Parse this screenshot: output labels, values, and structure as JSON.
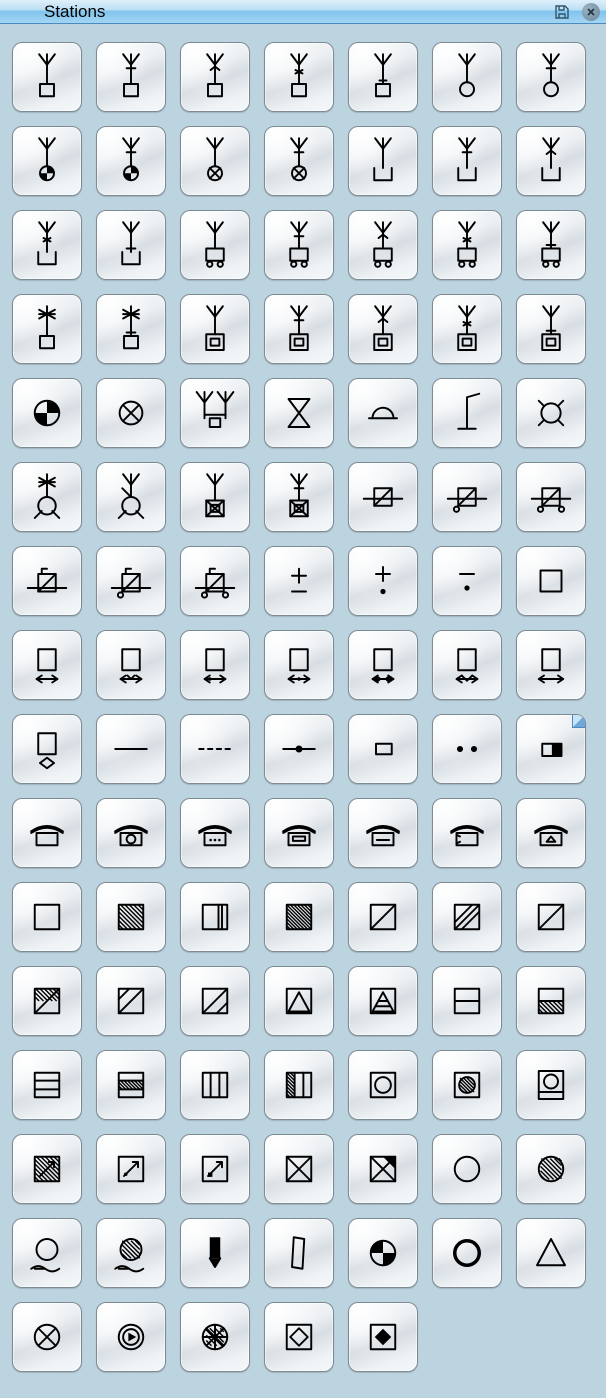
{
  "panel": {
    "title": "Stations",
    "save_tooltip": "Save",
    "close_tooltip": "Close"
  },
  "grid": {
    "columns": 7,
    "items": [
      {
        "id": "antenna-square-1",
        "label": "Antenna over square variant 1"
      },
      {
        "id": "antenna-square-2",
        "label": "Antenna over square variant 2"
      },
      {
        "id": "antenna-square-3",
        "label": "Antenna over square variant 3"
      },
      {
        "id": "antenna-square-4",
        "label": "Antenna over square variant 4"
      },
      {
        "id": "antenna-square-5",
        "label": "Antenna over square variant 5"
      },
      {
        "id": "antenna-circle-1",
        "label": "Antenna over circle"
      },
      {
        "id": "antenna-circle-2",
        "label": "Antenna over circle variant 2"
      },
      {
        "id": "antenna-filled-circle-1",
        "label": "Antenna over filled-sector circle 1"
      },
      {
        "id": "antenna-filled-circle-2",
        "label": "Antenna over filled-sector circle 2"
      },
      {
        "id": "antenna-cross-circle-1",
        "label": "Antenna over crossed circle 1"
      },
      {
        "id": "antenna-cross-circle-2",
        "label": "Antenna over crossed circle 2"
      },
      {
        "id": "antenna-open-box-1",
        "label": "Antenna over open-top box 1"
      },
      {
        "id": "antenna-open-box-2",
        "label": "Antenna over open-top box 2"
      },
      {
        "id": "antenna-open-box-3",
        "label": "Antenna over open-top box 3"
      },
      {
        "id": "antenna-open-box-4",
        "label": "Antenna over open-top box 4"
      },
      {
        "id": "antenna-open-box-5",
        "label": "Antenna over open-top box 5"
      },
      {
        "id": "antenna-wheels-1",
        "label": "Antenna over box with wheels 1"
      },
      {
        "id": "antenna-wheels-2",
        "label": "Antenna over box with wheels 2"
      },
      {
        "id": "antenna-wheels-3",
        "label": "Antenna over box with wheels 3"
      },
      {
        "id": "antenna-wheels-4",
        "label": "Antenna over box with wheels 4"
      },
      {
        "id": "antenna-wheels-5",
        "label": "Antenna over box with wheels 5"
      },
      {
        "id": "star-antenna-sq-1",
        "label": "Star-antenna over square 1"
      },
      {
        "id": "star-antenna-sq-2",
        "label": "Star-antenna over square 2"
      },
      {
        "id": "antenna-inner-sq-1",
        "label": "Antenna over box with inner square 1"
      },
      {
        "id": "antenna-inner-sq-2",
        "label": "Antenna over box with inner square 2"
      },
      {
        "id": "antenna-inner-sq-3",
        "label": "Antenna over box with inner square 3"
      },
      {
        "id": "antenna-inner-sq-4",
        "label": "Antenna over box with inner square 4"
      },
      {
        "id": "antenna-inner-sq-5",
        "label": "Antenna over box with inner square 5"
      },
      {
        "id": "bowtie-circle-filled",
        "label": "Filled bow-tie circle"
      },
      {
        "id": "crossed-circle",
        "label": "Crossed circle"
      },
      {
        "id": "two-antennas-box",
        "label": "Two antennas joined over box"
      },
      {
        "id": "hourglass",
        "label": "Hourglass symbol"
      },
      {
        "id": "half-dome",
        "label": "Half-dome over line"
      },
      {
        "id": "mast-line",
        "label": "Mast with top line"
      },
      {
        "id": "x-in-circle-corners",
        "label": "Circle with four corner ticks"
      },
      {
        "id": "star-cross-circle-1",
        "label": "Star-antenna over crossed circle 1"
      },
      {
        "id": "star-cross-circle-2",
        "label": "Star-antenna over crossed circle 2"
      },
      {
        "id": "antenna-x-in-box-1",
        "label": "Antenna over X-in-box 1"
      },
      {
        "id": "antenna-x-in-box-2",
        "label": "Antenna over X-in-box 2"
      },
      {
        "id": "diag-square-line-1",
        "label": "Square with diagonal on line 1"
      },
      {
        "id": "diag-square-line-2",
        "label": "Square with diagonal on line 2"
      },
      {
        "id": "diag-square-line-3",
        "label": "Square with diagonal on line 3"
      },
      {
        "id": "diag-square-tab-1",
        "label": "Square diagonal with tab 1"
      },
      {
        "id": "diag-square-tab-2",
        "label": "Square diagonal with tab 2"
      },
      {
        "id": "diag-square-tab-3",
        "label": "Square diagonal with tab 3"
      },
      {
        "id": "plus-minus",
        "label": "Plus over minus"
      },
      {
        "id": "plus-over-dot",
        "label": "Plus over dot"
      },
      {
        "id": "minus-over-dot",
        "label": "Minus over dot"
      },
      {
        "id": "empty-square",
        "label": "Empty square"
      },
      {
        "id": "square-underarrows-1",
        "label": "Square over converging arrows"
      },
      {
        "id": "square-underarrows-2",
        "label": "Square over arrows var 2"
      },
      {
        "id": "square-underarrows-3",
        "label": "Square over arrows var 3"
      },
      {
        "id": "square-underarrows-4",
        "label": "Square over arrows var 4"
      },
      {
        "id": "square-underarrows-5",
        "label": "Square over arrows var 5"
      },
      {
        "id": "square-underarrows-6",
        "label": "Square over arrows var 6"
      },
      {
        "id": "square-underarrows-7",
        "label": "Square over double arrow"
      },
      {
        "id": "square-underarrows-8",
        "label": "Square over arrows var 8"
      },
      {
        "id": "hline",
        "label": "Single horizontal line"
      },
      {
        "id": "dashed-line",
        "label": "Dashed horizontal line"
      },
      {
        "id": "line-dot",
        "label": "Line with center dot"
      },
      {
        "id": "small-rect",
        "label": "Small rectangle"
      },
      {
        "id": "two-dots",
        "label": "Two dots"
      },
      {
        "id": "filled-half-rect",
        "label": "Half-filled small rectangle",
        "dogear": true
      },
      {
        "id": "desk-phone-1",
        "label": "Desk symbol 1"
      },
      {
        "id": "desk-phone-2",
        "label": "Desk symbol with dial"
      },
      {
        "id": "desk-phone-3",
        "label": "Desk symbol with dots"
      },
      {
        "id": "desk-phone-4",
        "label": "Desk symbol with bar"
      },
      {
        "id": "desk-phone-5",
        "label": "Desk symbol plain"
      },
      {
        "id": "desk-phone-6",
        "label": "Desk symbol with speaker"
      },
      {
        "id": "desk-phone-7",
        "label": "Desk symbol with triangle"
      },
      {
        "id": "sq-outline",
        "label": "Square outline"
      },
      {
        "id": "sq-hatch-full",
        "label": "Fully hatched square"
      },
      {
        "id": "sq-vbar-right",
        "label": "Square with right vertical bar"
      },
      {
        "id": "sq-hatch-full-2",
        "label": "Fully hatched square 2"
      },
      {
        "id": "sq-diag",
        "label": "Square with diagonal"
      },
      {
        "id": "sq-multi-diag",
        "label": "Square with multiple diagonals"
      },
      {
        "id": "sq-diag-2",
        "label": "Square with diagonal 2"
      },
      {
        "id": "sq-half-hatch-diag",
        "label": "Half-hatched diagonal square"
      },
      {
        "id": "sq-diag-3",
        "label": "Square with diagonal 3"
      },
      {
        "id": "sq-diag-4",
        "label": "Square with diagonal 4"
      },
      {
        "id": "sq-triangle",
        "label": "Square with inner triangle"
      },
      {
        "id": "sq-striped-tri",
        "label": "Square with striped triangle"
      },
      {
        "id": "sq-split-h",
        "label": "Square split horizontally"
      },
      {
        "id": "sq-bottom-hatch",
        "label": "Square bottom-half hatched"
      },
      {
        "id": "sq-triple-h",
        "label": "Square three horizontal bands"
      },
      {
        "id": "sq-mid-hatch",
        "label": "Square middle band hatched"
      },
      {
        "id": "sq-vsplit",
        "label": "Square split vertically"
      },
      {
        "id": "sq-left-hatch-v",
        "label": "Square left-half hatched vertical"
      },
      {
        "id": "sq-inner-circle",
        "label": "Square with inner circle"
      },
      {
        "id": "sq-hatched-circle",
        "label": "Square with hatched circle"
      },
      {
        "id": "sq-circle-bar",
        "label": "Square, circle over bar"
      },
      {
        "id": "sq-hatch-arrow",
        "label": "Hatched square with arrow"
      },
      {
        "id": "sq-arrow-1",
        "label": "Square with inner arrow 1"
      },
      {
        "id": "sq-arrow-2",
        "label": "Square with inner arrow 2"
      },
      {
        "id": "sq-x",
        "label": "Square with X"
      },
      {
        "id": "sq-x-half",
        "label": "Square with half-filled X"
      },
      {
        "id": "circle-outline",
        "label": "Circle outline"
      },
      {
        "id": "circle-hatched",
        "label": "Hatched circle"
      },
      {
        "id": "circle-over-wave",
        "label": "Circle over wavy line"
      },
      {
        "id": "hatched-circle-wave",
        "label": "Hatched circle over wave"
      },
      {
        "id": "flag-down",
        "label": "Filled flag pointing down"
      },
      {
        "id": "quad",
        "label": "Quadrilateral shape"
      },
      {
        "id": "bowtie-circle",
        "label": "Bow-tie filled circle"
      },
      {
        "id": "ring-thick",
        "label": "Thick ring"
      },
      {
        "id": "triangle-up",
        "label": "Up-pointing triangle"
      },
      {
        "id": "circle-x",
        "label": "Circle with X"
      },
      {
        "id": "ring-dot-arrow",
        "label": "Ring with inner play"
      },
      {
        "id": "globe-hatch",
        "label": "Hatched globe"
      },
      {
        "id": "sq-diamond",
        "label": "Square with inner diamond"
      },
      {
        "id": "sq-diamond-fill",
        "label": "Square with filled diamond"
      }
    ]
  }
}
